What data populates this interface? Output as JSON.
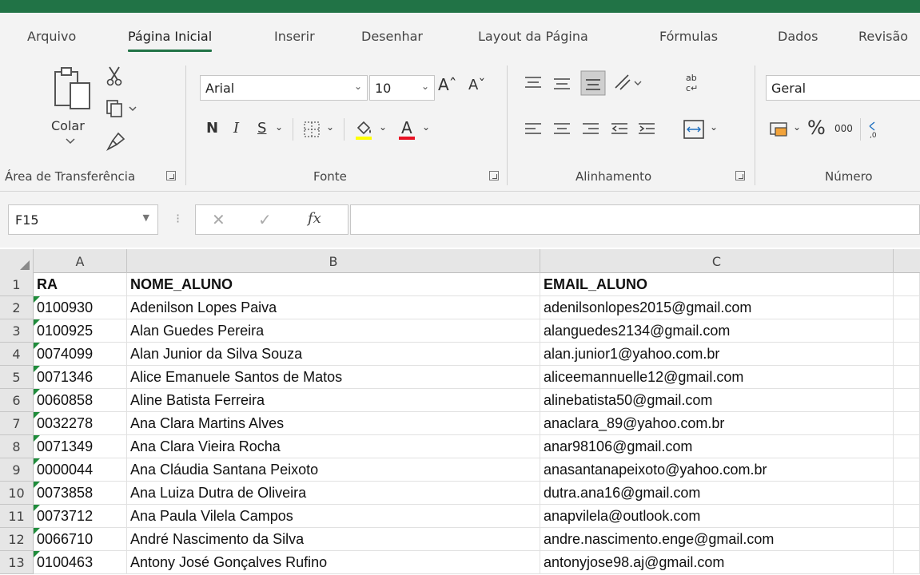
{
  "ribbon_tabs": [
    {
      "label": "Arquivo"
    },
    {
      "label": "Página Inicial"
    },
    {
      "label": "Inserir"
    },
    {
      "label": "Desenhar"
    },
    {
      "label": "Layout da Página"
    },
    {
      "label": "Fórmulas"
    },
    {
      "label": "Dados"
    },
    {
      "label": "Revisão"
    }
  ],
  "clipboard": {
    "paste_label": "Colar",
    "group_label": "Área de Transferência"
  },
  "font": {
    "name": "Arial",
    "size": "10",
    "bold": "N",
    "italic": "I",
    "underline": "S",
    "group_label": "Fonte",
    "highlight_color": "#ffff00",
    "font_color": "#e81123"
  },
  "alignment": {
    "group_label": "Alinhamento"
  },
  "number": {
    "format": "Geral",
    "percent": "%",
    "thousands": "000",
    "group_label": "Número"
  },
  "formula_bar": {
    "name_box": "F15",
    "fx": "fx",
    "value": ""
  },
  "columns": [
    "A",
    "B",
    "C"
  ],
  "rows": [
    {
      "num": "1",
      "ra": "RA",
      "nome": "NOME_ALUNO",
      "email": "EMAIL_ALUNO"
    },
    {
      "num": "2",
      "ra": "0100930",
      "nome": "Adenilson Lopes Paiva",
      "email": "adenilsonlopes2015@gmail.com"
    },
    {
      "num": "3",
      "ra": "0100925",
      "nome": "Alan Guedes Pereira",
      "email": "alanguedes2134@gmail.com"
    },
    {
      "num": "4",
      "ra": "0074099",
      "nome": "Alan Junior da Silva Souza",
      "email": "alan.junior1@yahoo.com.br"
    },
    {
      "num": "5",
      "ra": "0071346",
      "nome": "Alice Emanuele Santos de Matos",
      "email": "aliceemannuelle12@gmail.com"
    },
    {
      "num": "6",
      "ra": "0060858",
      "nome": "Aline Batista Ferreira",
      "email": "alinebatista50@gmail.com"
    },
    {
      "num": "7",
      "ra": "0032278",
      "nome": "Ana Clara Martins Alves",
      "email": "anaclara_89@yahoo.com.br"
    },
    {
      "num": "8",
      "ra": "0071349",
      "nome": "Ana Clara Vieira Rocha",
      "email": "anar98106@gmail.com"
    },
    {
      "num": "9",
      "ra": "0000044",
      "nome": "Ana Cláudia Santana Peixoto",
      "email": "anasantanapeixoto@yahoo.com.br"
    },
    {
      "num": "10",
      "ra": "0073858",
      "nome": "Ana Luiza Dutra de Oliveira",
      "email": "dutra.ana16@gmail.com"
    },
    {
      "num": "11",
      "ra": "0073712",
      "nome": "Ana Paula Vilela Campos",
      "email": "anapvilela@outlook.com"
    },
    {
      "num": "12",
      "ra": "0066710",
      "nome": "André Nascimento da Silva",
      "email": "andre.nascimento.enge@gmail.com"
    },
    {
      "num": "13",
      "ra": "0100463",
      "nome": "Antony José Gonçalves Rufino",
      "email": "antonyjose98.aj@gmail.com"
    }
  ]
}
